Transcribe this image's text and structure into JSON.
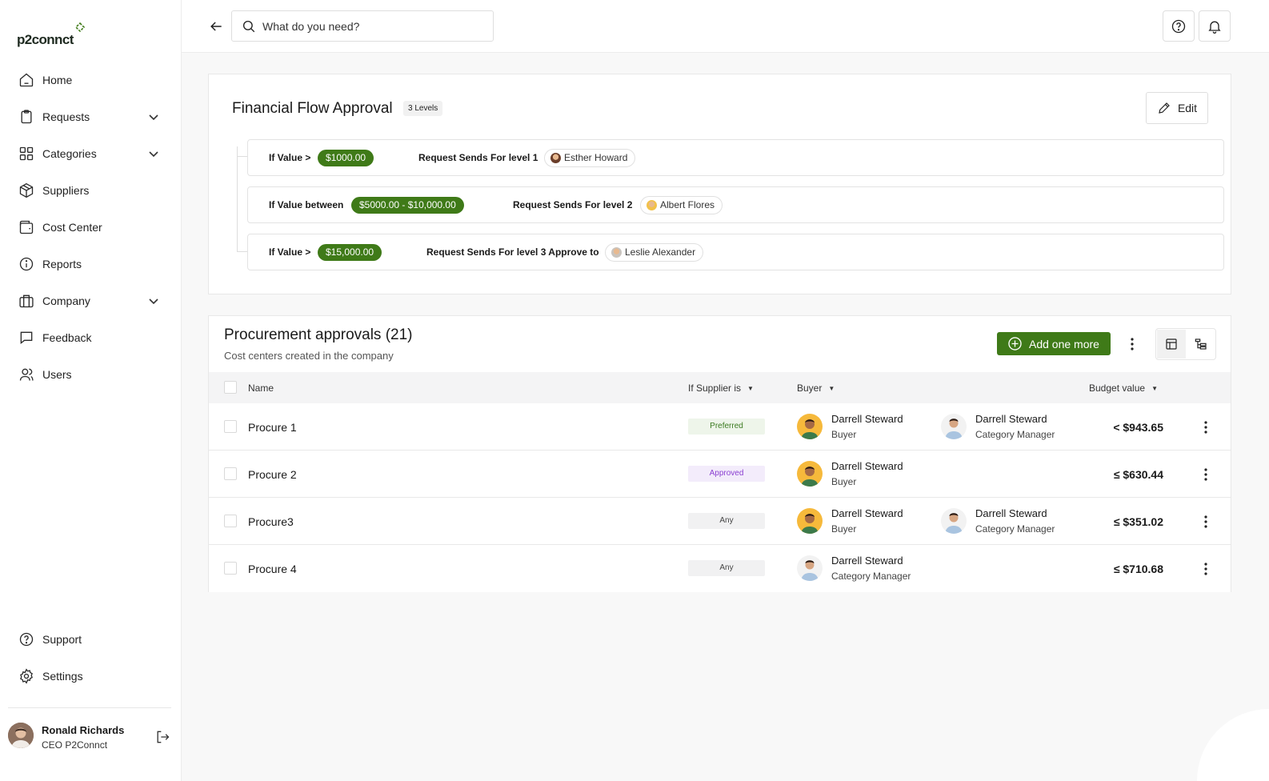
{
  "app": {
    "name": "p2connct"
  },
  "sidebar": {
    "items": [
      {
        "label": "Home",
        "icon": "home-icon"
      },
      {
        "label": "Requests",
        "icon": "clipboard-icon",
        "has_children": true
      },
      {
        "label": "Categories",
        "icon": "grid-icon",
        "has_children": true
      },
      {
        "label": "Suppliers",
        "icon": "box-icon"
      },
      {
        "label": "Cost Center",
        "icon": "wallet-icon"
      },
      {
        "label": "Reports",
        "icon": "info-icon"
      },
      {
        "label": "Company",
        "icon": "briefcase-icon",
        "has_children": true
      },
      {
        "label": "Feedback",
        "icon": "message-icon"
      },
      {
        "label": "Users",
        "icon": "users-icon"
      }
    ],
    "bottom": [
      {
        "label": "Support",
        "icon": "help-circle-icon"
      },
      {
        "label": "Settings",
        "icon": "gear-icon"
      }
    ],
    "profile": {
      "name": "Ronald Richards",
      "role": "CEO P2Connct"
    }
  },
  "topbar": {
    "search_placeholder": "What do you need?"
  },
  "flow": {
    "title": "Financial Flow Approval",
    "levels_badge": "3 Levels",
    "edit_label": "Edit",
    "rules": [
      {
        "condition": "If Value >",
        "value": "$1000.00",
        "action": "Request Sends For level 1",
        "approver": "Esther Howard"
      },
      {
        "condition": "If Value between",
        "value": "$5000.00 - $10,000.00",
        "action": "Request Sends For level 2",
        "approver": "Albert Flores"
      },
      {
        "condition": "If Value >",
        "value": "$15,000.00",
        "action": "Request Sends For level 3 Approve to",
        "approver": "Leslie Alexander"
      }
    ]
  },
  "approvals": {
    "title": "Procurement approvals (21)",
    "subtitle": "Cost centers created in the company",
    "add_label": "Add one more",
    "columns": {
      "name": "Name",
      "supplier": "If Supplier is",
      "buyer": "Buyer",
      "budget": "Budget value"
    },
    "rows": [
      {
        "name": "Procure 1",
        "supplier": "Preferred",
        "buyer": {
          "name": "Darrell Steward",
          "role": "Buyer"
        },
        "manager": {
          "name": "Darrell Steward",
          "role": "Category Manager"
        },
        "budget": "< $943.65"
      },
      {
        "name": "Procure 2",
        "supplier": "Approved",
        "buyer": {
          "name": "Darrell Steward",
          "role": "Buyer"
        },
        "budget": "≤ $630.44"
      },
      {
        "name": "Procure3",
        "supplier": "Any",
        "buyer": {
          "name": "Darrell Steward",
          "role": "Buyer"
        },
        "manager": {
          "name": "Darrell Steward",
          "role": "Category Manager"
        },
        "budget": "≤ $351.02"
      },
      {
        "name": "Procure 4",
        "supplier": "Any",
        "buyer": {
          "name": "Darrell Steward",
          "role": "Category Manager"
        },
        "budget": "≤ $710.68"
      }
    ]
  },
  "colors": {
    "brand_green": "#3f7a18",
    "preferred_bg": "#eef5ea",
    "preferred_text": "#3a7a20",
    "approved_bg": "#f3ecfb",
    "approved_text": "#8a3fd1",
    "any_bg": "#f1f1f2",
    "any_text": "#444444"
  }
}
